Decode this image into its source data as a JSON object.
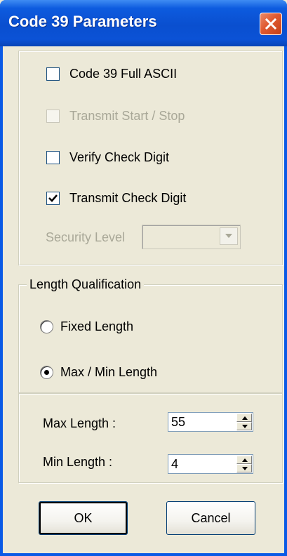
{
  "window": {
    "title": "Code 39 Parameters"
  },
  "options": {
    "full_ascii": {
      "label": "Code 39 Full ASCII",
      "checked": false,
      "enabled": true
    },
    "transmit_start_stop": {
      "label": "Transmit Start / Stop",
      "checked": false,
      "enabled": false
    },
    "verify_check_digit": {
      "label": "Verify Check Digit",
      "checked": false,
      "enabled": true
    },
    "transmit_check_digit": {
      "label": "Transmit Check Digit",
      "checked": true,
      "enabled": true
    },
    "security_level": {
      "label": "Security Level",
      "value": "",
      "enabled": false
    }
  },
  "length_qualification": {
    "legend": "Length Qualification",
    "fixed_length": {
      "label": "Fixed Length",
      "selected": false
    },
    "max_min_length": {
      "label": "Max / Min Length",
      "selected": true
    },
    "max_length": {
      "label": "Max Length :",
      "value": "55"
    },
    "min_length": {
      "label": "Min Length :",
      "value": "4"
    }
  },
  "buttons": {
    "ok": "OK",
    "cancel": "Cancel"
  },
  "colors": {
    "titlebar": "#0a4fcf",
    "close_button": "#e0592f",
    "dialog_face": "#ece9d8",
    "disabled_text": "#a9a898"
  },
  "icons": {
    "close": "close-icon",
    "check": "checkmark-icon",
    "dropdown": "chevron-down-icon",
    "spin_up": "spin-up-icon",
    "spin_down": "spin-down-icon"
  }
}
